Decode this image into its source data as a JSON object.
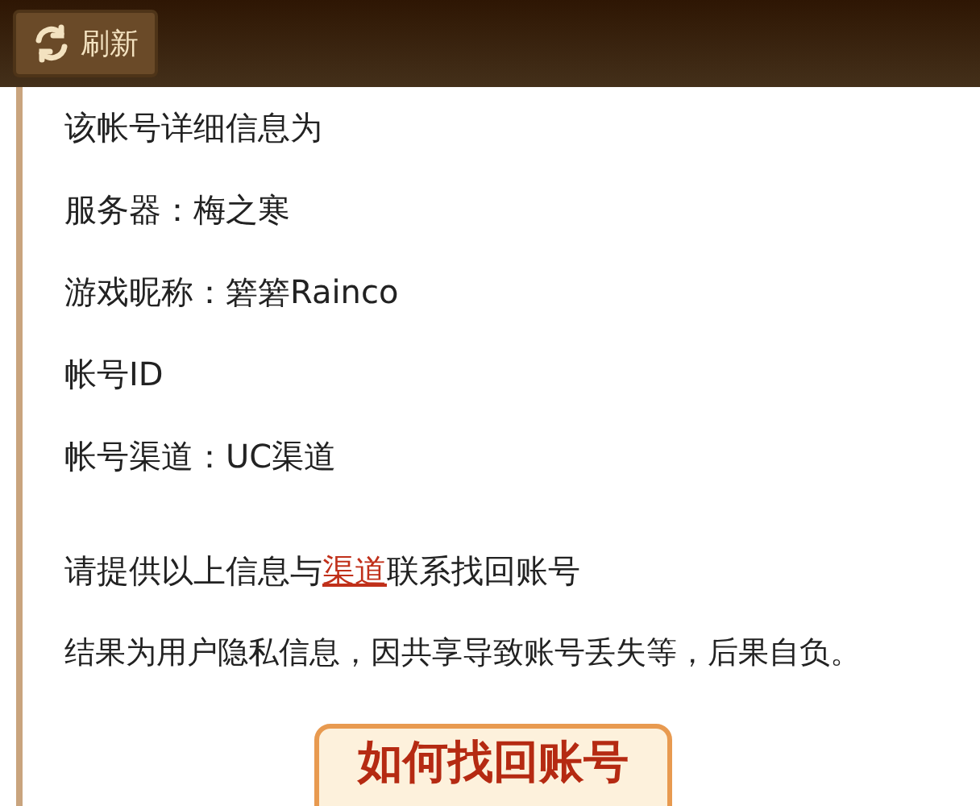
{
  "toolbar": {
    "refresh_button": {
      "label": "刷新"
    }
  },
  "info_lines": [
    "该帐号详细信息为",
    "服务器：梅之寒",
    "游戏昵称：箬箬Rainco",
    "帐号ID",
    "帐号渠道：UC渠道"
  ],
  "notice": {
    "before": "请提供以上信息与",
    "link": "渠道",
    "after": "联系找回账号"
  },
  "warning": "结果为用户隐私信息，因共享导致账号丢失等，后果自负。",
  "banner": {
    "title": "如何找回账号"
  }
}
